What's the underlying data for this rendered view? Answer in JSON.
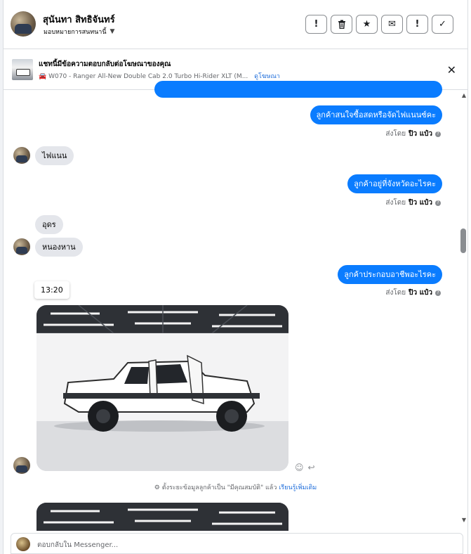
{
  "header": {
    "name": "สุนันทา สิทธิจันทร์",
    "assign_label": "มอบหมายการสนทนานี้",
    "actions": [
      {
        "icon": "alert-circle-icon",
        "glyph": "!"
      },
      {
        "icon": "trash-icon",
        "glyph": "🗑"
      },
      {
        "icon": "star-icon",
        "glyph": "★"
      },
      {
        "icon": "mail-icon",
        "glyph": "✉"
      },
      {
        "icon": "exclamation-icon",
        "glyph": "!"
      },
      {
        "icon": "check-icon",
        "glyph": "✓"
      }
    ]
  },
  "ad_banner": {
    "title": "แชทนี้มีข้อความตอบกลับต่อโฆษณาของคุณ",
    "subtitle": "W070 - Ranger All-New Double Cab 2.0 Turbo Hi-Rider XLT (M...",
    "link": "ดูโฆษณา",
    "close_glyph": "✕"
  },
  "messages": {
    "out_1": "ลูกค้าสนใจซื้อสดหรือจัดไฟแนนซ์คะ",
    "sent_prefix": "ส่งโดย",
    "sender": "ปิว แป๋ว",
    "in_1": "ไฟแนน",
    "out_2": "ลูกค้าอยู่ที่จังหวัดอะไรคะ",
    "in_2": "อุดร",
    "in_3": "หนองหาน",
    "out_3": "ลูกค้าประกอบอาชีพอะไรคะ",
    "time": "13:20"
  },
  "system_notice": {
    "text": "ตั้งระยะข้อมูลลูกค้าเป็น \"มีคุณสมบัติ\" แล้ว",
    "link": "เรียนรู้เพิ่มเติม"
  },
  "composer": {
    "placeholder": "ตอบกลับใน Messenger..."
  },
  "colors": {
    "accent": "#0a7cff",
    "incoming_bubble": "#e4e6eb",
    "link": "#216fdb"
  }
}
